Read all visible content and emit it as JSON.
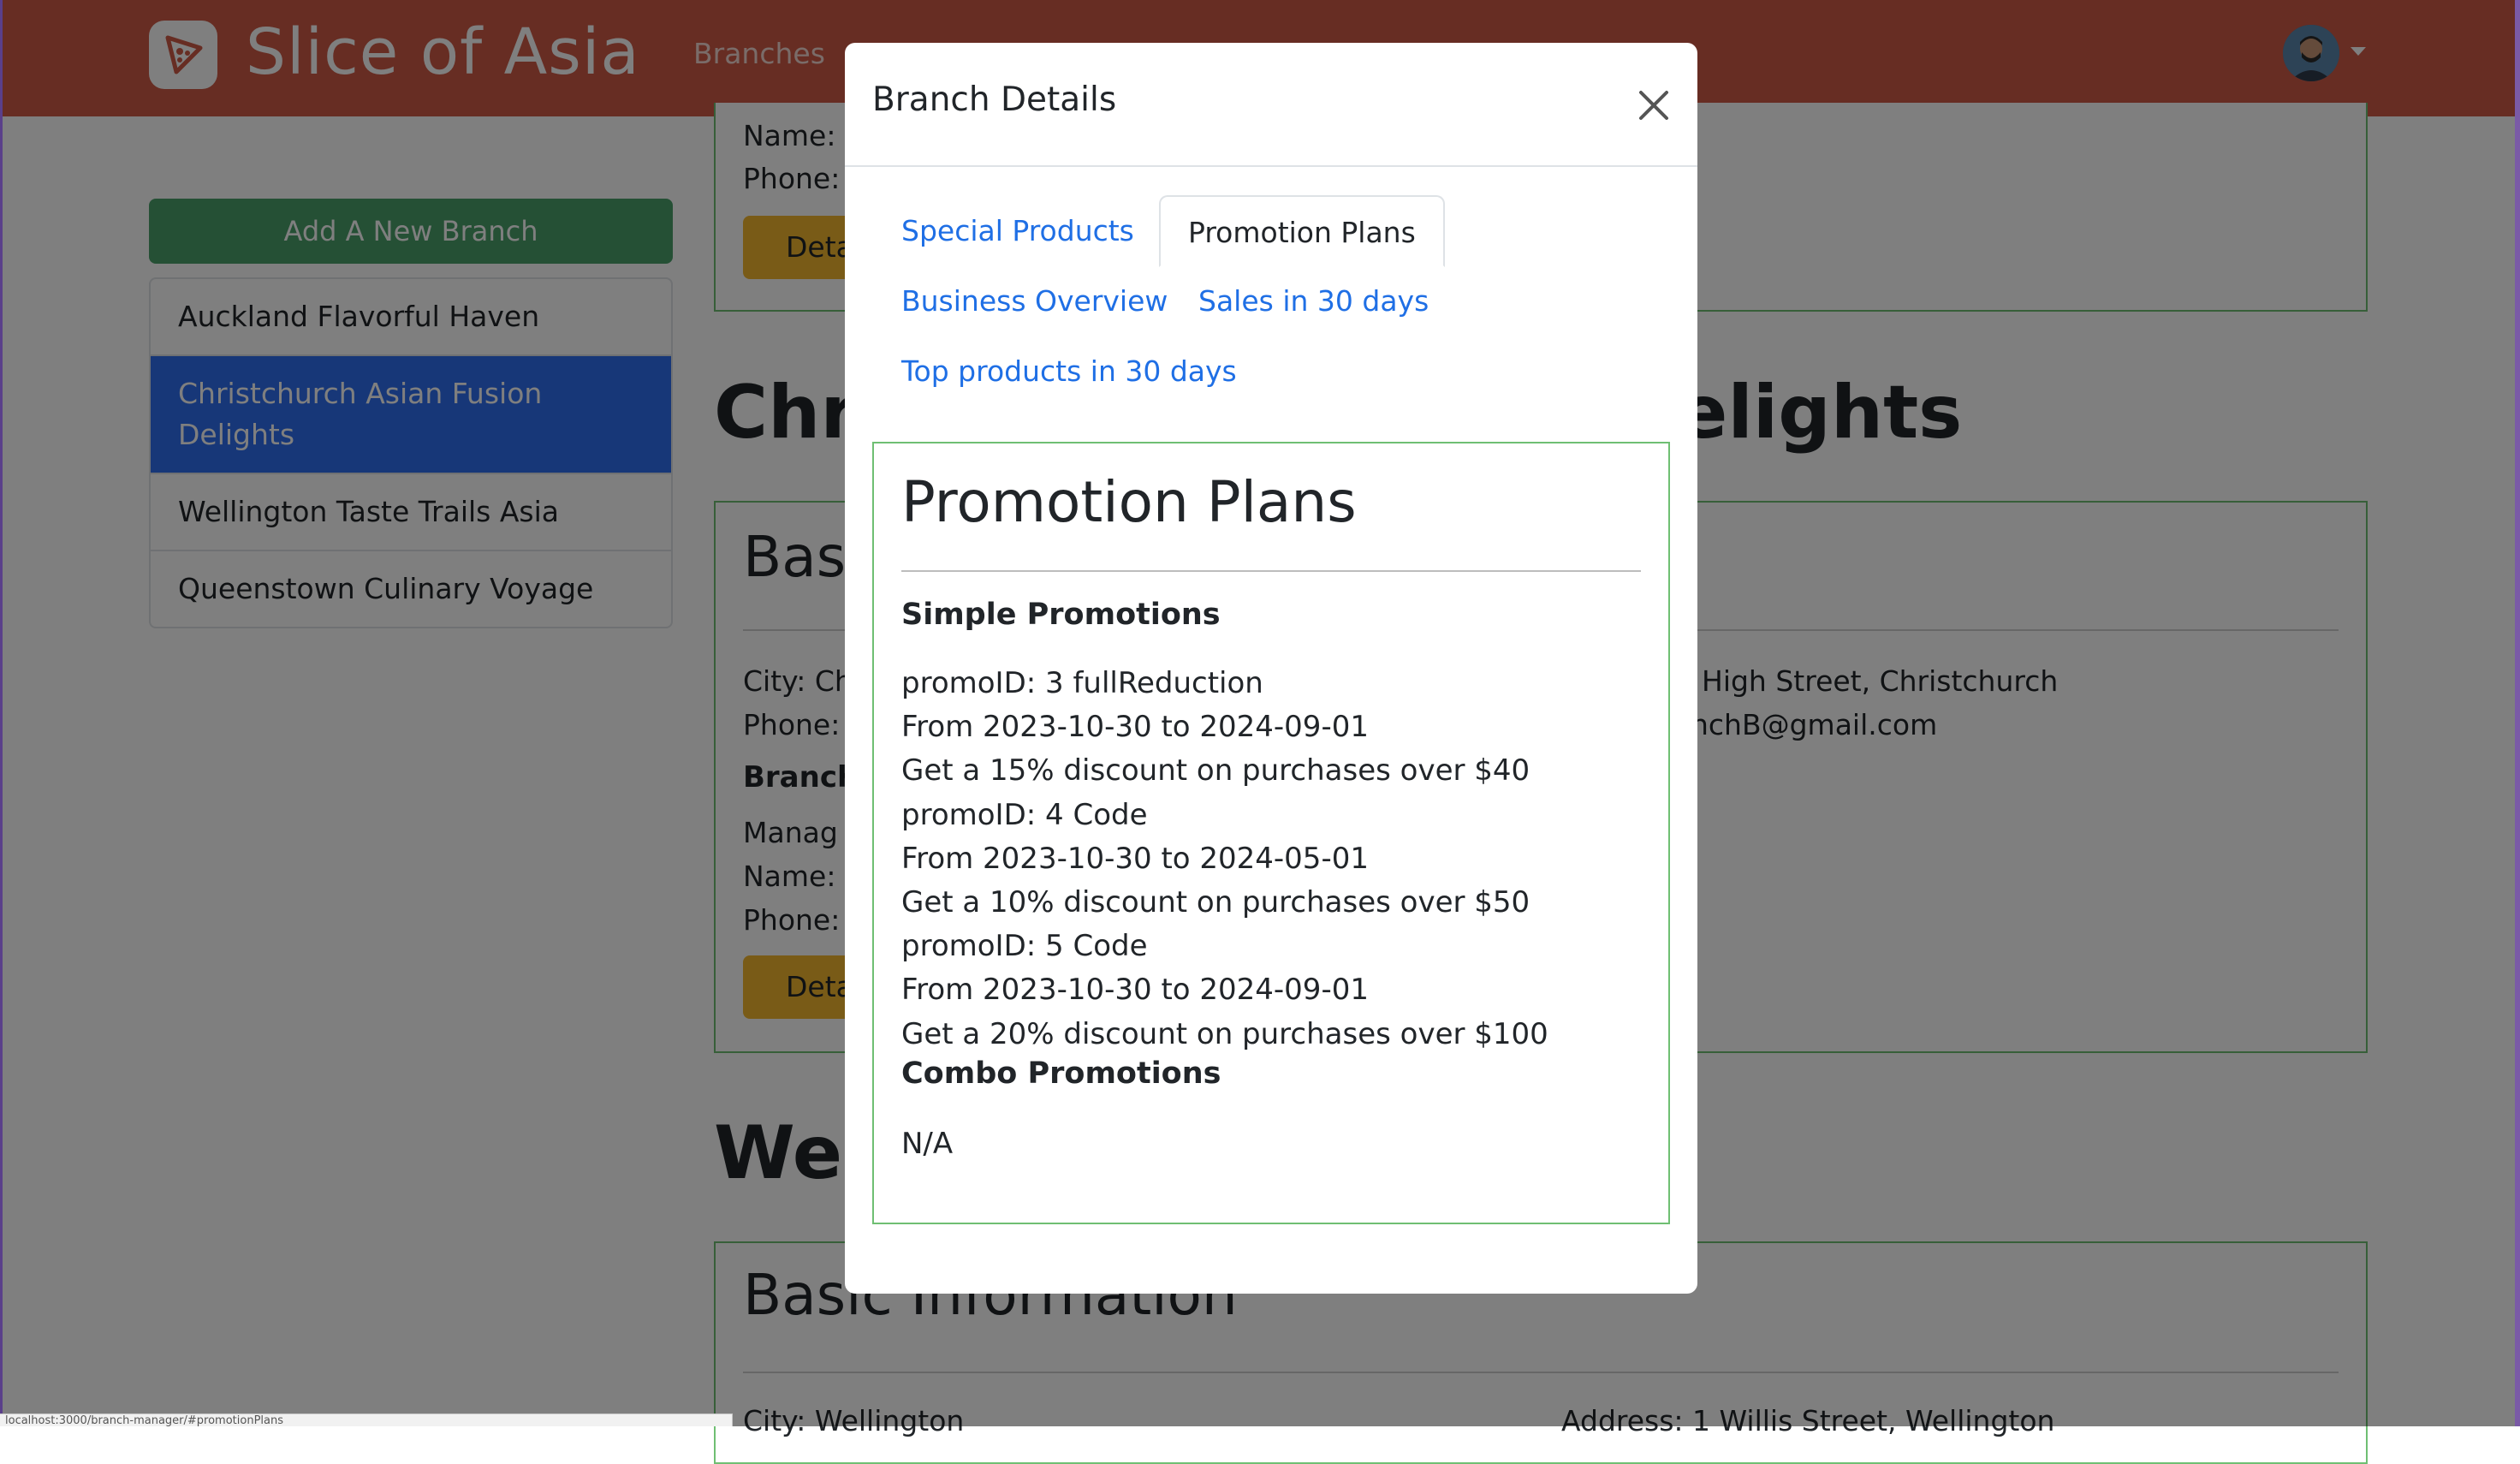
{
  "app": {
    "brand_name": "Slice of Asia",
    "nav": {
      "branches": "Branches"
    },
    "colors": {
      "navbar": "#cf5a46",
      "accent": "#2f6ff0",
      "success": "#4aa06a",
      "warning": "#f3b72e",
      "card_border": "#6fbf73"
    }
  },
  "sidebar": {
    "add_button": "Add A New Branch",
    "branches": [
      {
        "label": "Auckland Flavorful Haven",
        "active": false
      },
      {
        "label": "Christchurch Asian Fusion Delights",
        "active": true
      },
      {
        "label": "Wellington Taste Trails Asia",
        "active": false
      },
      {
        "label": "Queenstown Culinary Voyage",
        "active": false
      }
    ]
  },
  "background": {
    "top_card": {
      "name_label": "Name:",
      "phone_label": "Phone:",
      "details_button": "Details"
    },
    "christchurch": {
      "title_left": "Chri",
      "title_right": "elights",
      "basic_heading": "Bas",
      "city": "City: Ch",
      "address": "High Street, Christchurch",
      "phone": "Phone: (",
      "email": "nchB@gmail.com",
      "branch_heading": "Branch",
      "manager": "Manag",
      "name_label": "Name:",
      "phone_label": "Phone:",
      "details_button": "Details"
    },
    "wellington": {
      "title": "Wel",
      "basic_heading": "Basic Information",
      "city": "City: Wellington",
      "address": "Address: 1 Willis Street, Wellington"
    },
    "status_url": "localhost:3000/branch-manager/#promotionPlans"
  },
  "modal": {
    "title": "Branch Details",
    "tabs": [
      {
        "label": "Special Products",
        "active": false
      },
      {
        "label": "Promotion Plans",
        "active": true
      },
      {
        "label": "Business Overview",
        "active": false
      },
      {
        "label": "Sales in 30 days",
        "active": false
      },
      {
        "label": "Top products in 30 days",
        "active": false
      }
    ],
    "panel": {
      "title": "Promotion Plans",
      "simple_heading": "Simple Promotions",
      "simple_lines": [
        "promoID: 3 fullReduction",
        "From 2023-10-30 to 2024-09-01",
        "Get a 15% discount on purchases over $40",
        "promoID: 4 Code",
        "From 2023-10-30 to 2024-05-01",
        "Get a 10% discount on purchases over $50",
        "promoID: 5 Code",
        "From 2023-10-30 to 2024-09-01",
        "Get a 20% discount on purchases over $100"
      ],
      "combo_heading": "Combo Promotions",
      "combo_value": "N/A"
    }
  }
}
